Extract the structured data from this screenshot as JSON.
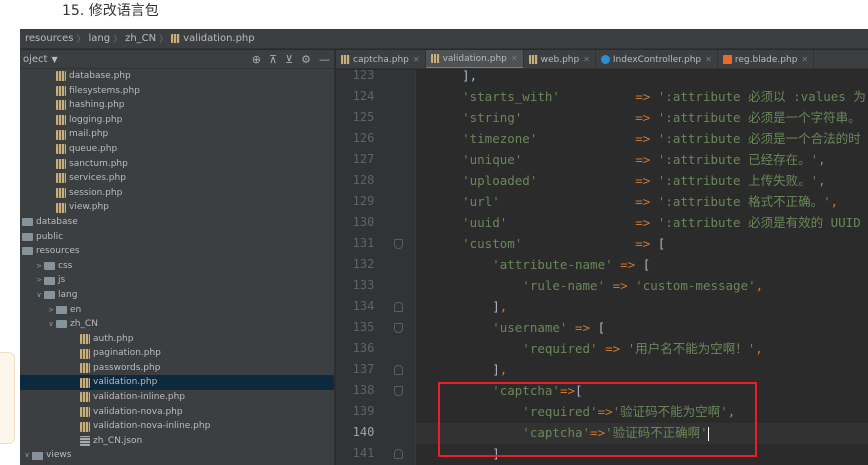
{
  "article": {
    "heading": "15. 修改语言包"
  },
  "breadcrumb": [
    "resources",
    "lang",
    "zh_CN",
    "validation.php"
  ],
  "project_panel": {
    "title": "oject",
    "tree": [
      {
        "label": "database.php",
        "type": "php",
        "indent": 2,
        "arrow": ""
      },
      {
        "label": "filesystems.php",
        "type": "php",
        "indent": 2,
        "arrow": ""
      },
      {
        "label": "hashing.php",
        "type": "php",
        "indent": 2,
        "arrow": ""
      },
      {
        "label": "logging.php",
        "type": "php",
        "indent": 2,
        "arrow": ""
      },
      {
        "label": "mail.php",
        "type": "php",
        "indent": 2,
        "arrow": ""
      },
      {
        "label": "queue.php",
        "type": "php",
        "indent": 2,
        "arrow": ""
      },
      {
        "label": "sanctum.php",
        "type": "php",
        "indent": 2,
        "arrow": ""
      },
      {
        "label": "services.php",
        "type": "php",
        "indent": 2,
        "arrow": ""
      },
      {
        "label": "session.php",
        "type": "php",
        "indent": 2,
        "arrow": ""
      },
      {
        "label": "view.php",
        "type": "php",
        "indent": 2,
        "arrow": ""
      },
      {
        "label": "database",
        "type": "folder",
        "indent": 0,
        "arrow": ""
      },
      {
        "label": "public",
        "type": "folder",
        "indent": 0,
        "arrow": ""
      },
      {
        "label": "resources",
        "type": "folder",
        "indent": 0,
        "arrow": ""
      },
      {
        "label": "css",
        "type": "folder",
        "indent": 1,
        "arrow": "closed"
      },
      {
        "label": "js",
        "type": "folder",
        "indent": 1,
        "arrow": "closed"
      },
      {
        "label": "lang",
        "type": "folder",
        "indent": 1,
        "arrow": "open"
      },
      {
        "label": "en",
        "type": "folder",
        "indent": 2,
        "arrow": "closed"
      },
      {
        "label": "zh_CN",
        "type": "folder",
        "indent": 2,
        "arrow": "open"
      },
      {
        "label": "auth.php",
        "type": "php",
        "indent": 4,
        "arrow": ""
      },
      {
        "label": "pagination.php",
        "type": "php",
        "indent": 4,
        "arrow": ""
      },
      {
        "label": "passwords.php",
        "type": "php",
        "indent": 4,
        "arrow": ""
      },
      {
        "label": "validation.php",
        "type": "php",
        "indent": 4,
        "arrow": "",
        "selected": true
      },
      {
        "label": "validation-inline.php",
        "type": "php",
        "indent": 4,
        "arrow": ""
      },
      {
        "label": "validation-nova.php",
        "type": "php",
        "indent": 4,
        "arrow": ""
      },
      {
        "label": "validation-nova-inline.php",
        "type": "php",
        "indent": 4,
        "arrow": ""
      },
      {
        "label": "zh_CN.json",
        "type": "json",
        "indent": 4,
        "arrow": ""
      },
      {
        "label": "views",
        "type": "folder",
        "indent": 0,
        "arrow": "open"
      }
    ]
  },
  "tabs": [
    {
      "label": "captcha.php",
      "icon": "php",
      "active": false
    },
    {
      "label": "validation.php",
      "icon": "php",
      "active": true
    },
    {
      "label": "web.php",
      "icon": "php",
      "active": false
    },
    {
      "label": "IndexController.php",
      "icon": "ctrl",
      "active": false
    },
    {
      "label": "reg.blade.php",
      "icon": "blade",
      "active": false
    }
  ],
  "editor": {
    "current_line": 140,
    "lines": [
      {
        "n": 123,
        "fold": "",
        "tokens": [
          [
            "p",
            "    ],"
          ]
        ]
      },
      {
        "n": 124,
        "fold": "",
        "tokens": [
          [
            "s",
            "    'starts_with'"
          ],
          [
            "p",
            "          "
          ],
          [
            "o",
            "=>"
          ],
          [
            "p",
            " "
          ],
          [
            "s",
            "':attribute 必须以 :values 为"
          ]
        ]
      },
      {
        "n": 125,
        "fold": "",
        "tokens": [
          [
            "s",
            "    'string'"
          ],
          [
            "p",
            "               "
          ],
          [
            "o",
            "=>"
          ],
          [
            "p",
            " "
          ],
          [
            "s",
            "':attribute 必须是一个字符串。"
          ]
        ]
      },
      {
        "n": 126,
        "fold": "",
        "tokens": [
          [
            "s",
            "    'timezone'"
          ],
          [
            "p",
            "             "
          ],
          [
            "o",
            "=>"
          ],
          [
            "p",
            " "
          ],
          [
            "s",
            "':attribute 必须是一个合法的时"
          ]
        ]
      },
      {
        "n": 127,
        "fold": "",
        "tokens": [
          [
            "s",
            "    'unique'"
          ],
          [
            "p",
            "               "
          ],
          [
            "o",
            "=>"
          ],
          [
            "p",
            " "
          ],
          [
            "s",
            "':attribute 已经存在。'"
          ],
          [
            "o",
            ","
          ]
        ]
      },
      {
        "n": 128,
        "fold": "",
        "tokens": [
          [
            "s",
            "    'uploaded'"
          ],
          [
            "p",
            "             "
          ],
          [
            "o",
            "=>"
          ],
          [
            "p",
            " "
          ],
          [
            "s",
            "':attribute 上传失败。'"
          ],
          [
            "o",
            ","
          ]
        ]
      },
      {
        "n": 129,
        "fold": "",
        "tokens": [
          [
            "s",
            "    'url'"
          ],
          [
            "p",
            "                  "
          ],
          [
            "o",
            "=>"
          ],
          [
            "p",
            " "
          ],
          [
            "s",
            "':attribute 格式不正确。'"
          ],
          [
            "o",
            ","
          ]
        ]
      },
      {
        "n": 130,
        "fold": "",
        "tokens": [
          [
            "s",
            "    'uuid'"
          ],
          [
            "p",
            "                 "
          ],
          [
            "o",
            "=>"
          ],
          [
            "p",
            " "
          ],
          [
            "s",
            "':attribute 必须是有效的 UUID"
          ]
        ]
      },
      {
        "n": 131,
        "fold": "down",
        "tokens": [
          [
            "s",
            "    'custom'"
          ],
          [
            "p",
            "               "
          ],
          [
            "o",
            "=>"
          ],
          [
            "p",
            " ["
          ]
        ]
      },
      {
        "n": 132,
        "fold": "",
        "tokens": [
          [
            "s",
            "        'attribute-name'"
          ],
          [
            "p",
            " "
          ],
          [
            "o",
            "=>"
          ],
          [
            "p",
            " ["
          ]
        ]
      },
      {
        "n": 133,
        "fold": "",
        "tokens": [
          [
            "s",
            "            'rule-name'"
          ],
          [
            "p",
            " "
          ],
          [
            "o",
            "=>"
          ],
          [
            "p",
            " "
          ],
          [
            "s",
            "'custom-message'"
          ],
          [
            "o",
            ","
          ]
        ]
      },
      {
        "n": 134,
        "fold": "up",
        "tokens": [
          [
            "p",
            "        ]"
          ],
          [
            "o",
            ","
          ]
        ]
      },
      {
        "n": 135,
        "fold": "down",
        "tokens": [
          [
            "s",
            "        'username'"
          ],
          [
            "p",
            " "
          ],
          [
            "o",
            "=>"
          ],
          [
            "p",
            " ["
          ]
        ]
      },
      {
        "n": 136,
        "fold": "",
        "tokens": [
          [
            "s",
            "            'required'"
          ],
          [
            "p",
            " "
          ],
          [
            "o",
            "=>"
          ],
          [
            "p",
            " "
          ],
          [
            "s",
            "'用户名不能为空啊！'"
          ],
          [
            "o",
            ","
          ]
        ]
      },
      {
        "n": 137,
        "fold": "up",
        "tokens": [
          [
            "p",
            "        ]"
          ],
          [
            "o",
            ","
          ]
        ]
      },
      {
        "n": 138,
        "fold": "down",
        "tokens": [
          [
            "s",
            "        'captcha'"
          ],
          [
            "o",
            "=>"
          ],
          [
            "p",
            "["
          ]
        ]
      },
      {
        "n": 139,
        "fold": "",
        "tokens": [
          [
            "s",
            "            'required'"
          ],
          [
            "o",
            "=>"
          ],
          [
            "s",
            "'验证码不能为空啊'"
          ],
          [
            "o",
            ","
          ]
        ]
      },
      {
        "n": 140,
        "fold": "",
        "tokens": [
          [
            "s",
            "            'captcha'"
          ],
          [
            "o",
            "=>"
          ],
          [
            "s",
            "'验证码不正确啊'"
          ]
        ],
        "cursor": true
      },
      {
        "n": 141,
        "fold": "up",
        "tokens": [
          [
            "p",
            "        ]"
          ]
        ]
      }
    ]
  },
  "colors": {
    "editor_bg": "#2b2b2b",
    "string": "#6a8759",
    "operator": "#cc7832",
    "highlight_box": "#e8202a"
  }
}
